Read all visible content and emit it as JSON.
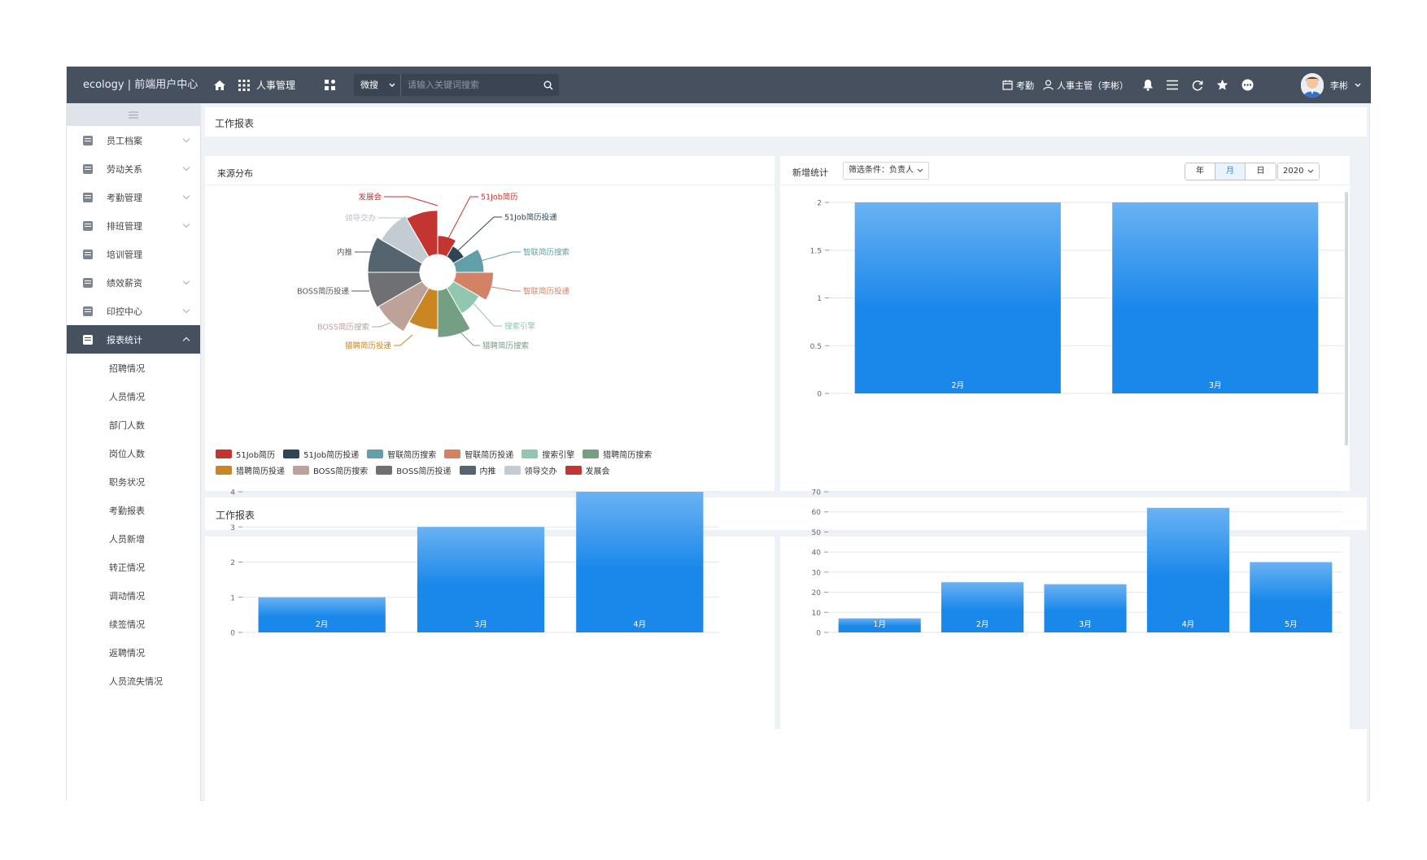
{
  "topbar": {
    "brand": "ecology | 前端用户中心",
    "module": "人事管理",
    "search_select": "微搜",
    "search_placeholder": "请输入关键词搜索",
    "attendance": "考勤",
    "role": "人事主管（李彬）",
    "username": "李彬"
  },
  "sidebar": {
    "items": [
      {
        "label": "员工档案",
        "chevron": true
      },
      {
        "label": "劳动关系",
        "chevron": true
      },
      {
        "label": "考勤管理",
        "chevron": true
      },
      {
        "label": "排班管理",
        "chevron": true
      },
      {
        "label": "培训管理",
        "chevron": false
      },
      {
        "label": "绩效薪资",
        "chevron": true
      },
      {
        "label": "印控中心",
        "chevron": true
      },
      {
        "label": "报表统计",
        "chevron": true,
        "active": true
      }
    ],
    "subitems": [
      "招聘情况",
      "人员情况",
      "部门人数",
      "岗位人数",
      "职务状况",
      "考勤报表",
      "人员新增",
      "转正情况",
      "调动情况",
      "续签情况",
      "返聘情况",
      "人员流失情况"
    ]
  },
  "main": {
    "header_title": "工作报表",
    "source_title": "来源分布",
    "new_title": "新增统计",
    "filter_label": "筛选条件：负责人",
    "seg": [
      "年",
      "月",
      "日"
    ],
    "seg_active": 1,
    "year": "2020",
    "second_title": "工作报表"
  },
  "colors": {
    "bar_top": "#6ab2f3",
    "bar_bottom": "#1a88ea",
    "topbar": "#46505f"
  },
  "chart_data": [
    {
      "type": "pie",
      "variant": "rose",
      "title": "来源分布",
      "slices": [
        {
          "name": "51Job简历",
          "value": 1.2,
          "color": "#c23531"
        },
        {
          "name": "51Job投递",
          "value": 0.8,
          "color": "#2f4554"
        },
        {
          "name": "智联简历搜索",
          "value": 1.8,
          "color": "#61a0a8"
        },
        {
          "name": "智联简历投递",
          "value": 2.4,
          "color": "#d48265"
        },
        {
          "name": "搜索引擎",
          "value": 1.9,
          "color": "#91c7ae"
        },
        {
          "name": "猎聘简历搜索",
          "value": 3.0,
          "color": "#749f83"
        },
        {
          "name": "猎聘简历投递",
          "value": 2.5,
          "color": "#ca8622"
        },
        {
          "name": "BOSS简历搜索",
          "value": 3.2,
          "color": "#bda29a"
        },
        {
          "name": "BOSS简历投递",
          "value": 3.3,
          "color": "#6e7074"
        },
        {
          "name": "内推",
          "value": 3.3,
          "color": "#546570"
        },
        {
          "name": "领导交办",
          "value": 3.0,
          "color": "#c4ccd3"
        },
        {
          "name": "发展会",
          "value": 2.8,
          "color": "#c23531"
        }
      ],
      "legend": [
        "51Job简历",
        "51Job简历投递",
        "智联简历搜索",
        "智联简历投递",
        "搜索引擎",
        "猎聘简历搜索",
        "猎聘简历投递",
        "BOSS简历搜索",
        "BOSS简历投递",
        "内推",
        "领导交办",
        "发展会"
      ],
      "legend_colors": [
        "#c23531",
        "#2f4554",
        "#61a0a8",
        "#d48265",
        "#91c7ae",
        "#749f83",
        "#ca8622",
        "#bda29a",
        "#6e7074",
        "#546570",
        "#c4ccd3",
        "#c23531"
      ],
      "labels": [
        "发展会",
        "领导交办",
        "内推",
        "BOSS简历投递",
        "BOSS简历搜索",
        "猎聘简历投递",
        "51Job简历",
        "51Job简历投递",
        "智联简历搜索",
        "智联简历投递",
        "搜索引擎",
        "猎聘简历搜索"
      ]
    },
    {
      "type": "bar",
      "title": "新增统计",
      "categories": [
        "2月",
        "3月"
      ],
      "values": [
        2,
        2
      ],
      "yticks": [
        0,
        0.5,
        1,
        1.5,
        2
      ],
      "ylim": [
        0,
        2
      ]
    },
    {
      "type": "bar",
      "categories": [
        "2月",
        "3月",
        "4月"
      ],
      "values": [
        1,
        3,
        4
      ],
      "yticks": [
        0,
        1,
        2,
        3,
        4
      ],
      "ylim": [
        0,
        4
      ]
    },
    {
      "type": "bar",
      "categories": [
        "1月",
        "2月",
        "3月",
        "4月",
        "5月"
      ],
      "values": [
        7,
        25,
        24,
        62,
        35
      ],
      "yticks": [
        0,
        10,
        20,
        30,
        40,
        50,
        60,
        70
      ],
      "ylim": [
        0,
        70
      ]
    }
  ]
}
